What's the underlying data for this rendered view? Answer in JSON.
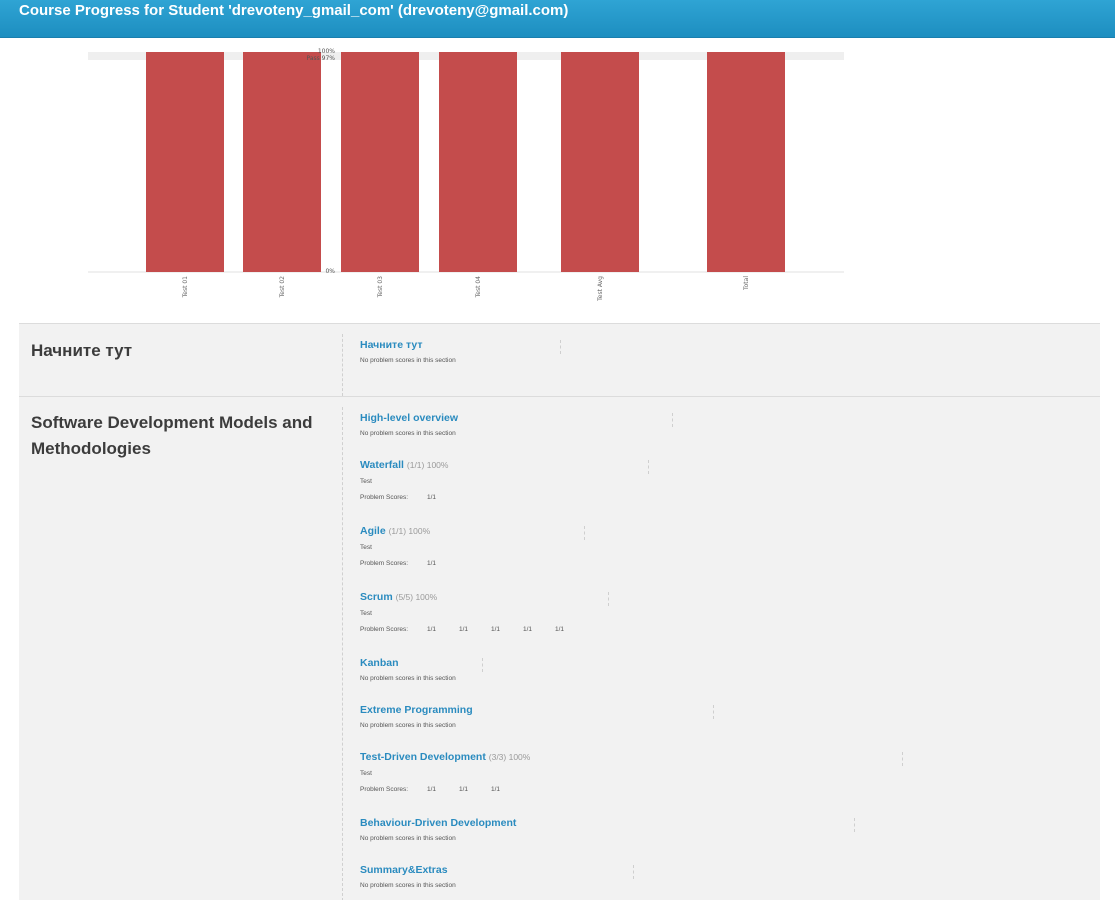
{
  "header": {
    "title": "Course Progress for Student 'drevoteny_gmail_com' (drevoteny@gmail.com)"
  },
  "colors": {
    "header_bg": "#2196c9",
    "bar": "#c44c4c",
    "link": "#2a8bbf"
  },
  "chart_data": {
    "type": "bar",
    "categories": [
      "Test 01",
      "Test 02",
      "Test 03",
      "Test 04",
      "Test Avg",
      "Total"
    ],
    "values": [
      100,
      100,
      100,
      100,
      100,
      100
    ],
    "ylim": [
      0,
      100
    ],
    "tick_labels": {
      "top": "100%",
      "pass": "Pass 97%",
      "bottom": "0%"
    },
    "pass_threshold": 97,
    "grid": false
  },
  "chapters": [
    {
      "title": "Начните тут",
      "sections": [
        {
          "title": "Начните тут",
          "score": "",
          "note": "No problem scores in this section"
        }
      ]
    },
    {
      "title": "Software Development Models and Methodologies",
      "sections": [
        {
          "title": "High-level overview",
          "score": "",
          "note": "No problem scores in this section"
        },
        {
          "title": "Waterfall",
          "score": "(1/1) 100%",
          "label": "Test",
          "scores_label": "Problem Scores:",
          "scores": [
            "1/1"
          ]
        },
        {
          "title": "Agile",
          "score": "(1/1) 100%",
          "label": "Test",
          "scores_label": "Problem Scores:",
          "scores": [
            "1/1"
          ]
        },
        {
          "title": "Scrum",
          "score": "(5/5) 100%",
          "label": "Test",
          "scores_label": "Problem Scores:",
          "scores": [
            "1/1",
            "1/1",
            "1/1",
            "1/1",
            "1/1"
          ]
        },
        {
          "title": "Kanban",
          "score": "",
          "note": "No problem scores in this section"
        },
        {
          "title": "Extreme Programming",
          "score": "",
          "note": "No problem scores in this section"
        },
        {
          "title": "Test-Driven Development",
          "score": "(3/3) 100%",
          "label": "Test",
          "scores_label": "Problem Scores:",
          "scores": [
            "1/1",
            "1/1",
            "1/1"
          ]
        },
        {
          "title": "Behaviour-Driven Development",
          "score": "",
          "note": "No problem scores in this section"
        },
        {
          "title": "Summary&Extras",
          "score": "",
          "note": "No problem scores in this section"
        }
      ]
    }
  ]
}
